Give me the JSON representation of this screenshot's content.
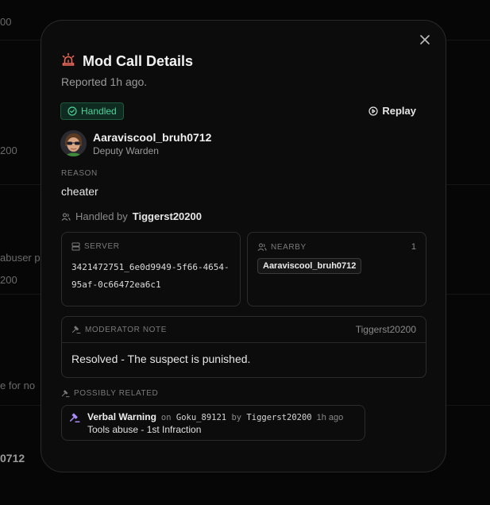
{
  "background": {
    "fragments": [
      "00",
      "200",
      "abuser p",
      "200",
      "e for no",
      "0712"
    ]
  },
  "modal": {
    "title": "Mod Call Details",
    "subtitle": "Reported 1h ago.",
    "status_badge": "Handled",
    "replay_label": "Replay",
    "user": {
      "name": "Aaraviscool_bruh0712",
      "role": "Deputy Warden"
    },
    "reason_label": "REASON",
    "reason": "cheater",
    "handled_by_prefix": "Handled by",
    "handled_by": "Tiggerst20200",
    "server": {
      "label": "SERVER",
      "id_line1": "3421472751_6e0d9949-5f66-4654-",
      "id_line2": "95af-0c66472ea6c1"
    },
    "nearby": {
      "label": "NEARBY",
      "count": "1",
      "players": [
        "Aaraviscool_bruh0712"
      ]
    },
    "moderator_note": {
      "label": "MODERATOR NOTE",
      "author": "Tiggerst20200",
      "text": "Resolved - The suspect is punished."
    },
    "possibly_related": {
      "label": "POSSIBLY RELATED",
      "items": [
        {
          "title": "Verbal Warning",
          "on_word": "on",
          "target": "Goku_89121",
          "by_word": "by",
          "moderator": "Tiggerst20200",
          "time": "1h ago",
          "description": "Tools abuse - 1st Infraction"
        }
      ]
    }
  },
  "colors": {
    "accent_success": "#4fd39a",
    "siren_icon": "#f26b5b",
    "hammer_icon": "#a98cf5"
  }
}
